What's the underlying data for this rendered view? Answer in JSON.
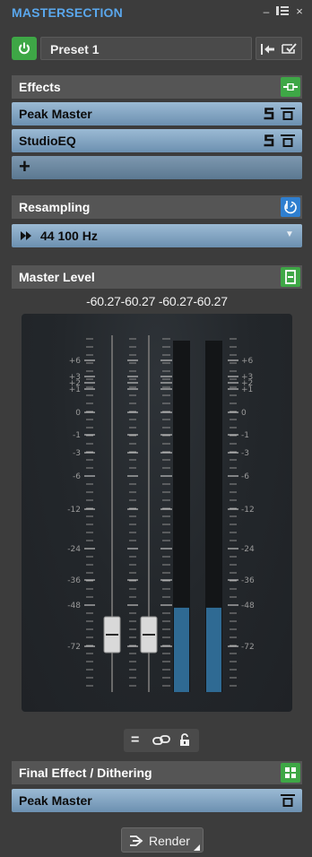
{
  "window": {
    "title": "MASTERSECTION"
  },
  "preset": {
    "name": "Preset 1"
  },
  "effects": {
    "title": "Effects",
    "slots": [
      {
        "label": "Peak Master"
      },
      {
        "label": "StudioEQ"
      }
    ],
    "add_label": "+"
  },
  "resampling": {
    "title": "Resampling",
    "value": "44 100 Hz"
  },
  "master_level": {
    "title": "Master Level",
    "readout": "-60.27-60.27  -60.27-60.27",
    "scale_labels": [
      "+6",
      "+3",
      "+2",
      "+1",
      "0",
      "-1",
      "-3",
      "-6",
      "-12",
      "-24",
      "-36",
      "-48",
      "-72"
    ],
    "meter_level_fraction": 0.24
  },
  "final_effect": {
    "title": "Final Effect / Dithering",
    "slot_label": "Peak Master"
  },
  "render": {
    "label": "Render"
  },
  "colors": {
    "accent_title": "#5aa7ec",
    "power_green": "#3ea746",
    "slot_blue": "#7d9fbe",
    "meter_blue": "#2f6a93"
  }
}
